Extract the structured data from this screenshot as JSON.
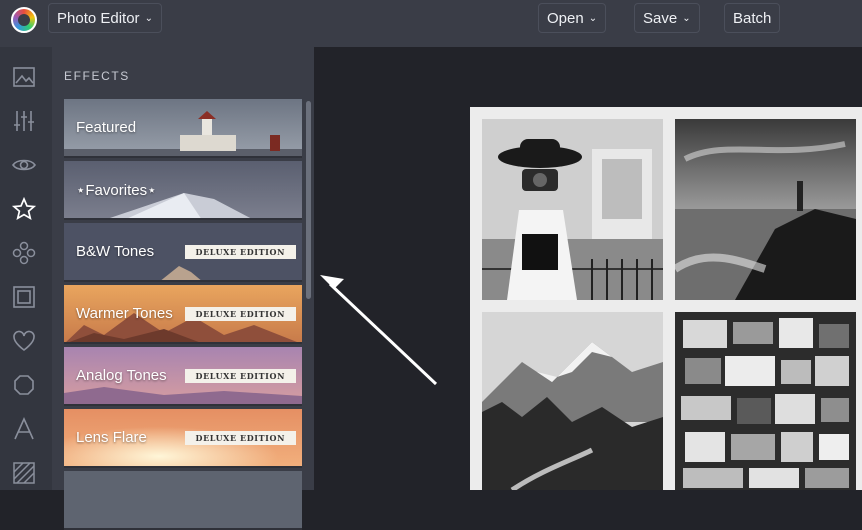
{
  "app": {
    "name": "Photo Editor"
  },
  "toolbar": {
    "app_menu_label": "Photo Editor",
    "open_label": "Open",
    "save_label": "Save",
    "batch_label": "Batch"
  },
  "rail": {
    "icons": [
      "image-icon",
      "sliders-icon",
      "eye-icon",
      "star-icon",
      "texture-icon",
      "frame-icon",
      "heart-icon",
      "shape-icon",
      "text-icon",
      "hatch-icon"
    ],
    "active": "star-icon"
  },
  "panel": {
    "title": "EFFECTS",
    "badge": "DELUXE EDITION",
    "items": [
      {
        "label": "Featured",
        "deluxe": false
      },
      {
        "label": "⋆Favorites⋆",
        "deluxe": false
      },
      {
        "label": "B&W Tones",
        "deluxe": true
      },
      {
        "label": "Warmer Tones",
        "deluxe": true
      },
      {
        "label": "Analog Tones",
        "deluxe": true
      },
      {
        "label": "Lens Flare",
        "deluxe": true
      }
    ]
  },
  "colors": {
    "topbar": "#3a3d47",
    "rail": "#33363f",
    "panel": "#3a3d47",
    "canvas": "#222329",
    "accent": "#ffffff"
  }
}
